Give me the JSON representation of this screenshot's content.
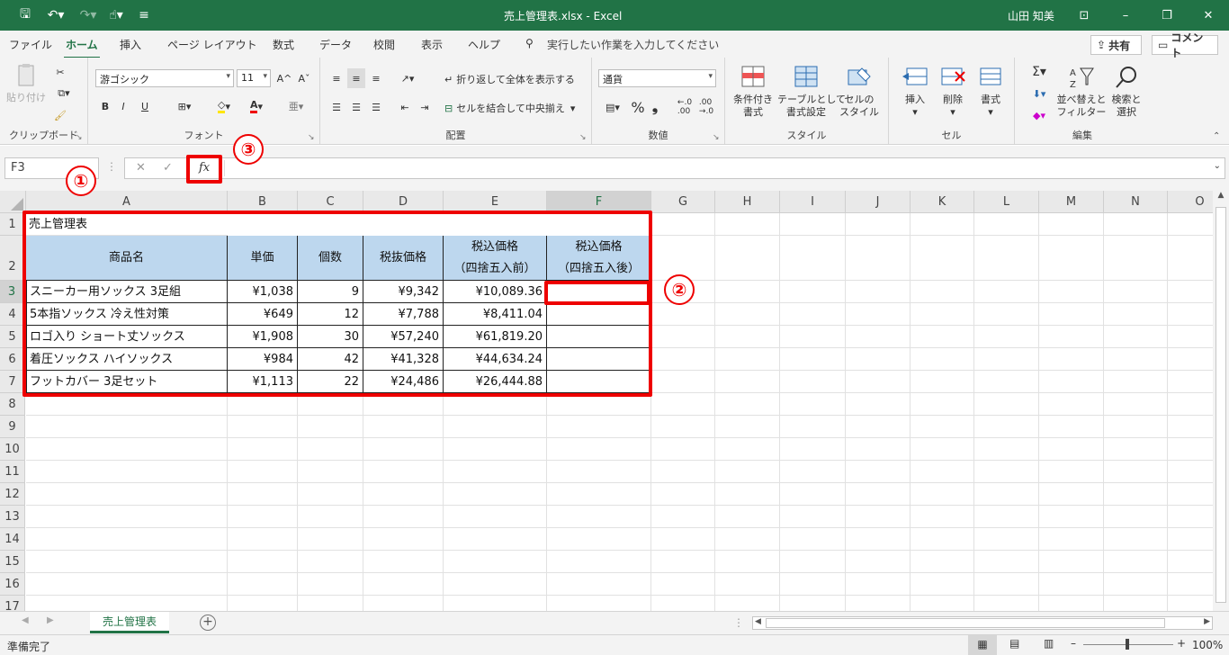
{
  "window": {
    "title": "売上管理表.xlsx  -  Excel",
    "user": "山田 知美",
    "minimize": "–",
    "restore": "❐",
    "close": "✕",
    "ribbon_display": "⊡"
  },
  "tabs": [
    "ファイル",
    "ホーム",
    "挿入",
    "ページ レイアウト",
    "数式",
    "データ",
    "校閲",
    "表示",
    "ヘルプ"
  ],
  "tell_me": "実行したい作業を入力してください",
  "share_label": "共有",
  "comment_label": "コメント",
  "ribbon": {
    "clipboard": {
      "paste": "貼り付け",
      "label": "クリップボード"
    },
    "font": {
      "name": "游ゴシック",
      "size": "11",
      "bold": "B",
      "italic": "I",
      "underline": "U",
      "grow": "A^",
      "shrink": "Aˇ",
      "label": "フォント"
    },
    "alignment": {
      "wrap": "折り返して全体を表示する",
      "merge": "セルを結合して中央揃え",
      "label": "配置"
    },
    "number": {
      "format": "通貨",
      "percent": "%",
      "comma": "❟",
      "label": "数値"
    },
    "styles": {
      "conditional": "条件付き\n書式",
      "table": "テーブルとして\n書式設定",
      "cell_styles": "セルの\nスタイル",
      "label": "スタイル"
    },
    "cells": {
      "insert": "挿入",
      "delete": "削除",
      "format": "書式",
      "label": "セル"
    },
    "editing": {
      "sort": "並べ替えと\nフィルター",
      "find": "検索と\n選択",
      "label": "編集"
    }
  },
  "formula_bar": {
    "name_box": "F3",
    "cancel": "✕",
    "enter": "✓",
    "fx": "fx",
    "value": ""
  },
  "columns": [
    "A",
    "B",
    "C",
    "D",
    "E",
    "F",
    "G",
    "H",
    "I",
    "J",
    "K",
    "L",
    "M",
    "N",
    "O"
  ],
  "rows": [
    "1",
    "2",
    "3",
    "4",
    "5",
    "6",
    "7",
    "8",
    "9",
    "10",
    "11",
    "12",
    "13",
    "14",
    "15",
    "16",
    "17"
  ],
  "sheet": {
    "title": "売上管理表",
    "headers": [
      "商品名",
      "単価",
      "個数",
      "税抜価格",
      "税込価格\n（四捨五入前）",
      "税込価格\n（四捨五入後）"
    ],
    "data": [
      [
        "スニーカー用ソックス 3足組",
        "¥1,038",
        "9",
        "¥9,342",
        "¥10,089.36",
        ""
      ],
      [
        "5本指ソックス 冷え性対策",
        "¥649",
        "12",
        "¥7,788",
        "¥8,411.04",
        ""
      ],
      [
        "ロゴ入り ショート丈ソックス",
        "¥1,908",
        "30",
        "¥57,240",
        "¥61,819.20",
        ""
      ],
      [
        "着圧ソックス ハイソックス",
        "¥984",
        "42",
        "¥41,328",
        "¥44,634.24",
        ""
      ],
      [
        "フットカバー 3足セット",
        "¥1,113",
        "22",
        "¥24,486",
        "¥26,444.88",
        ""
      ]
    ]
  },
  "annotations": [
    "①",
    "②",
    "③"
  ],
  "sheet_tab": "売上管理表",
  "status": {
    "ready": "準備完了",
    "zoom": "100%"
  },
  "accent": "#217346",
  "annotation_color": "#e00000"
}
